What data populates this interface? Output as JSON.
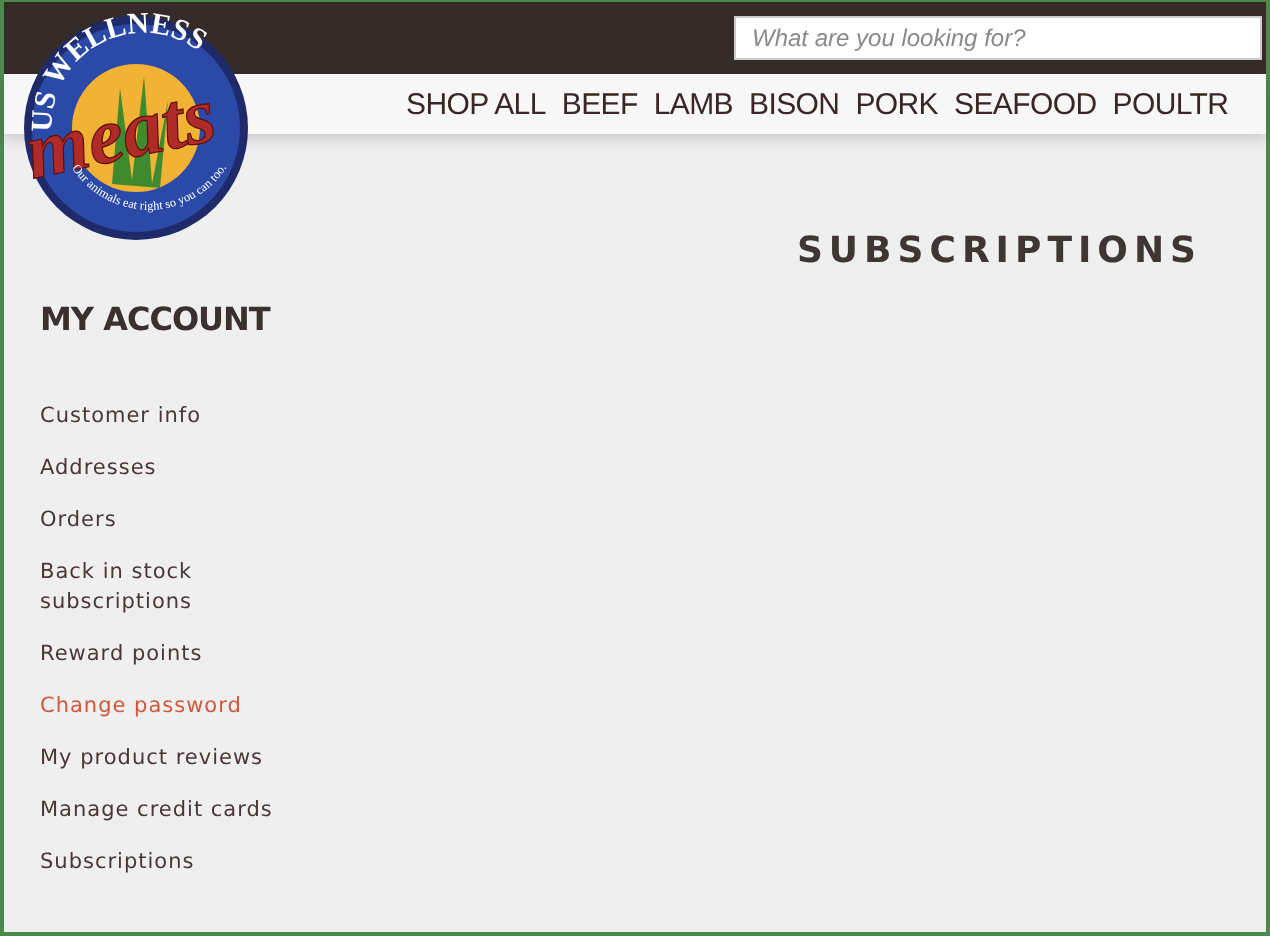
{
  "logo": {
    "top_text": "US WELLNESS",
    "main_text": "meats",
    "tagline": "Our animals eat right so you can too."
  },
  "search": {
    "placeholder": "What are you looking for?"
  },
  "nav": [
    "SHOP ALL",
    "BEEF",
    "LAMB",
    "BISON",
    "PORK",
    "SEAFOOD",
    "POULTR"
  ],
  "page_title": "SUBSCRIPTIONS",
  "sidebar": {
    "title": "MY ACCOUNT",
    "items": [
      {
        "label": "Customer info",
        "selected": false
      },
      {
        "label": "Addresses",
        "selected": false
      },
      {
        "label": "Orders",
        "selected": false
      },
      {
        "label": "Back in stock subscriptions",
        "selected": false
      },
      {
        "label": "Reward points",
        "selected": false
      },
      {
        "label": "Change password",
        "selected": true
      },
      {
        "label": "My product reviews",
        "selected": false
      },
      {
        "label": "Manage credit cards",
        "selected": false
      },
      {
        "label": "Subscriptions",
        "selected": false
      }
    ]
  }
}
